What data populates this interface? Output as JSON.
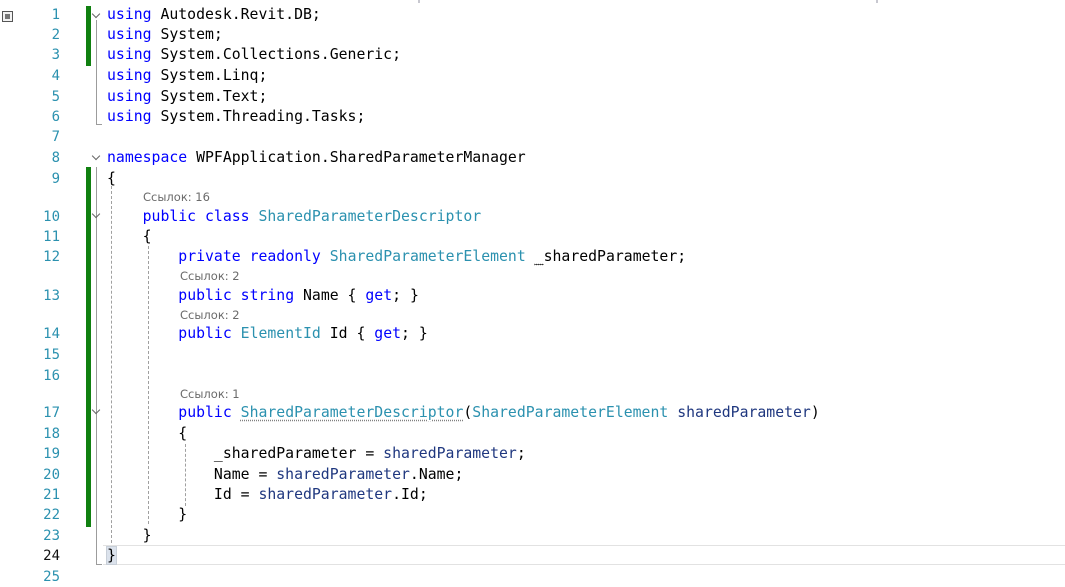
{
  "editor": {
    "gutter_icon": "breakpoint-margin-icon",
    "colors": {
      "keyword": "#0000ff",
      "type": "#2b91af",
      "parameter": "#1f377f",
      "line_number": "#2b91af",
      "change_bar": "#108010"
    },
    "current_line": 24,
    "line_numbers": [
      "1",
      "2",
      "3",
      "4",
      "5",
      "6",
      "7",
      "8",
      "9",
      "10",
      "11",
      "12",
      "13",
      "14",
      "15",
      "16",
      "17",
      "18",
      "19",
      "20",
      "21",
      "22",
      "23",
      "24",
      "25"
    ],
    "code": {
      "l1": [
        "using",
        " Autodesk.Revit.DB;"
      ],
      "l2": [
        "using",
        " System;"
      ],
      "l3": [
        "using",
        " System.Collections.Generic;"
      ],
      "l4": [
        "using",
        " System.Linq;"
      ],
      "l5": [
        "using",
        " System.Text;"
      ],
      "l6": [
        "using",
        " System.Threading.Tasks;"
      ],
      "l8": [
        "namespace",
        " WPFApplication.SharedParameterManager"
      ],
      "l9": "{",
      "l10": [
        "public",
        " ",
        "class",
        " ",
        "SharedParameterDescriptor"
      ],
      "l11": "{",
      "l12": [
        "private",
        " ",
        "readonly",
        " ",
        "SharedParameterElement",
        " ",
        "_",
        "sharedParameter;"
      ],
      "l13": [
        "public",
        " ",
        "string",
        " Name { ",
        "get",
        "; }"
      ],
      "l14": [
        "public",
        " ",
        "ElementId",
        " Id { ",
        "get",
        "; }"
      ],
      "l17": [
        "public",
        " ",
        "SharedParameterDescriptor",
        "(",
        "SharedParameterElement",
        " ",
        "sharedParameter",
        ")"
      ],
      "l18": "{",
      "l19": [
        "_sharedParameter = ",
        "sharedParameter",
        ";"
      ],
      "l20": [
        "Name = ",
        "sharedParameter",
        ".Name;"
      ],
      "l21": [
        "Id = ",
        "sharedParameter",
        ".Id;"
      ],
      "l22": "}",
      "l23": "}",
      "l24": "}"
    },
    "lens": {
      "class_refs": "Ссылок: 16",
      "name_refs": "Ссылок: 2",
      "id_refs": "Ссылок: 2",
      "ctor_refs": "Ссылок: 1"
    }
  }
}
